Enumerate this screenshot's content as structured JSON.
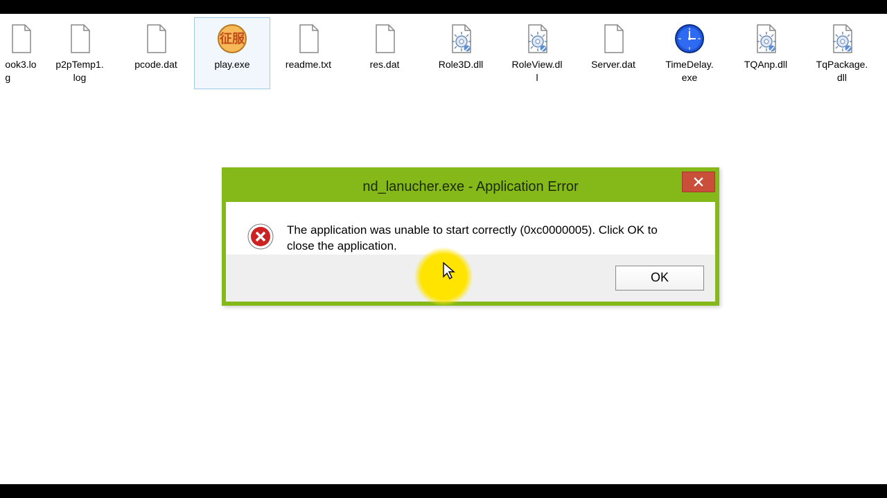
{
  "desktop": {
    "icons": [
      {
        "name": "ook3.log",
        "type": "file",
        "partial": true,
        "label_lines": [
          "ook3.lo",
          "g"
        ]
      },
      {
        "name": "p2pTemp1.log",
        "type": "file",
        "label_lines": [
          "p2pTemp1.",
          "log"
        ]
      },
      {
        "name": "pcode.dat",
        "type": "file",
        "label_lines": [
          "pcode.dat"
        ]
      },
      {
        "name": "play.exe",
        "type": "exe-custom",
        "label_lines": [
          "play.exe"
        ],
        "selected": true
      },
      {
        "name": "readme.txt",
        "type": "file",
        "label_lines": [
          "readme.txt"
        ]
      },
      {
        "name": "res.dat",
        "type": "file",
        "label_lines": [
          "res.dat"
        ]
      },
      {
        "name": "Role3D.dll",
        "type": "dll",
        "label_lines": [
          "Role3D.dll"
        ]
      },
      {
        "name": "RoleView.dll",
        "type": "dll",
        "label_lines": [
          "RoleView.dl",
          "l"
        ]
      },
      {
        "name": "Server.dat",
        "type": "file",
        "label_lines": [
          "Server.dat"
        ]
      },
      {
        "name": "TimeDelay.exe",
        "type": "exe-clock",
        "label_lines": [
          "TimeDelay.",
          "exe"
        ]
      },
      {
        "name": "TQAnp.dll",
        "type": "dll",
        "label_lines": [
          "TQAnp.dll"
        ]
      },
      {
        "name": "TqPackage.dll",
        "type": "dll",
        "label_lines": [
          "TqPackage.",
          "dll"
        ]
      }
    ]
  },
  "dialog": {
    "title": "nd_lanucher.exe - Application Error",
    "message": "The application was unable to start correctly (0xc0000005). Click OK to close the application.",
    "ok_label": "OK"
  }
}
